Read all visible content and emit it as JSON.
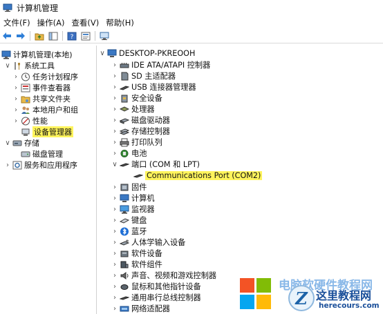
{
  "window": {
    "title": "计算机管理"
  },
  "menubar": [
    {
      "label": "文件(F)"
    },
    {
      "label": "操作(A)"
    },
    {
      "label": "查看(V)"
    },
    {
      "label": "帮助(H)"
    }
  ],
  "left_tree": {
    "root": "计算机管理(本地)",
    "system_tools": "系统工具",
    "task_scheduler": "任务计划程序",
    "event_viewer": "事件查看器",
    "shared_folders": "共享文件夹",
    "local_users": "本地用户和组",
    "performance": "性能",
    "device_manager": "设备管理器",
    "storage": "存储",
    "disk_management": "磁盘管理",
    "services_apps": "服务和应用程序"
  },
  "device_tree": {
    "root": "DESKTOP-PKREOOH",
    "ide": "IDE ATA/ATAPI 控制器",
    "sd": "SD 主适配器",
    "usb": "USB 连接器管理器",
    "security": "安全设备",
    "processors": "处理器",
    "disk_drives": "磁盘驱动器",
    "storage_ctrl": "存储控制器",
    "print_queue": "打印队列",
    "battery": "电池",
    "ports": "端口 (COM 和 LPT)",
    "comm_port": "Communications Port (COM2)",
    "firmware": "固件",
    "computer": "计算机",
    "monitors": "监视器",
    "keyboard": "键盘",
    "bluetooth": "蓝牙",
    "hid": "人体学输入设备",
    "software_devices": "软件设备",
    "software_components": "软件组件",
    "sound": "声音、视频和游戏控制器",
    "mice": "鼠标和其他指针设备",
    "usb_ctrl": "通用串行总线控制器",
    "network": "网络适配器"
  },
  "watermark": {
    "ghost_text": "电脑软硬件教程网",
    "badge_letter": "Z",
    "site_name": "这里教程网",
    "url": "herecours.com"
  },
  "colors": {
    "highlight": "#fff45c",
    "accent": "#2a7fd6",
    "watermark_text": "#1a4f9a"
  }
}
